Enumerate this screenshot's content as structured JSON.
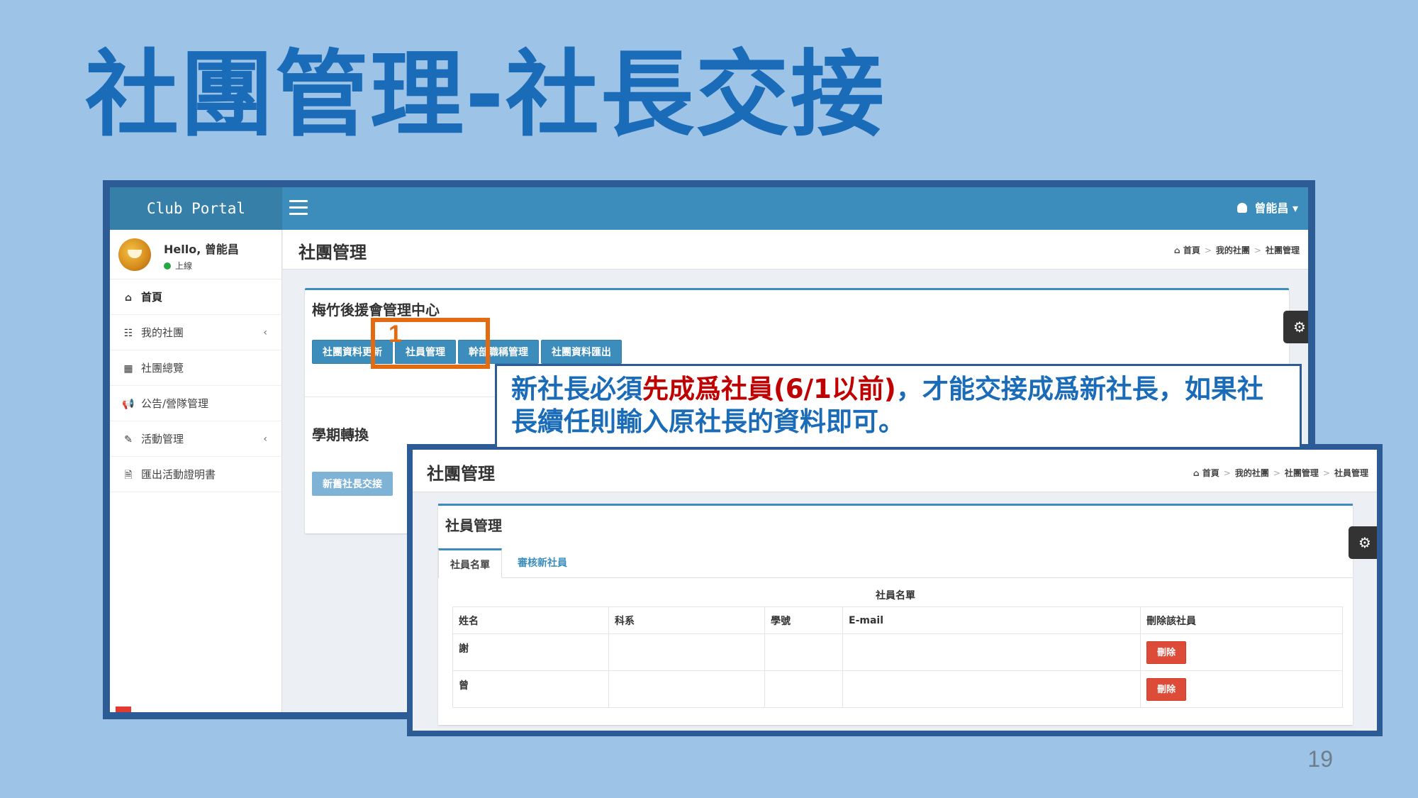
{
  "slide": {
    "title": "社團管理-社長交接",
    "page_number": "19"
  },
  "portal": {
    "logo": "Club Portal",
    "user_name": "曾能昌",
    "caret": "▾",
    "hello": "Hello, 曾能昌",
    "status": "上線",
    "menu": [
      {
        "label": "首頁",
        "icon": "home-icon",
        "glyph": "⌂"
      },
      {
        "label": "我的社團",
        "icon": "grid-icon",
        "glyph": "☷"
      },
      {
        "label": "社團總覽",
        "icon": "table-icon",
        "glyph": "▦"
      },
      {
        "label": "公告/營隊管理",
        "icon": "bullhorn-icon",
        "glyph": "📢"
      },
      {
        "label": "活動管理",
        "icon": "edit-icon",
        "glyph": "✎"
      },
      {
        "label": "匯出活動證明書",
        "icon": "document-icon",
        "glyph": "🗎"
      }
    ],
    "chevron": "‹",
    "page_title": "社團管理",
    "breadcrumb": [
      "首頁",
      "我的社團",
      "社團管理"
    ],
    "breadcrumb_sep": ">",
    "home_glyph": "⌂",
    "gear_glyph": "⚙",
    "box_title": "梅竹後援會管理中心",
    "buttons": [
      "社團資料更新",
      "社員管理",
      "幹部職稱管理",
      "社團資料匯出"
    ],
    "section_title": "學期轉換",
    "semester_button": "新舊社長交接"
  },
  "callout": {
    "part1": "新社長必須",
    "part2_red": "先成爲社員(6/1以前)",
    "part3": "，才能交接成爲新社長，如果社長續任則輸入原社長的資料即可。"
  },
  "highlight": {
    "step_number": "1"
  },
  "members_screen": {
    "page_title": "社團管理",
    "breadcrumb": [
      "首頁",
      "我的社團",
      "社團管理",
      "社員管理"
    ],
    "box_title": "社員管理",
    "tabs": [
      "社員名單",
      "審核新社員"
    ],
    "table_caption": "社員名單",
    "columns": [
      "姓名",
      "科系",
      "學號",
      "E-mail",
      "刪除該社員"
    ],
    "rows": [
      {
        "name": "謝",
        "dept": "",
        "id": "",
        "email": "",
        "action": "刪除"
      },
      {
        "name": "曾",
        "dept": "",
        "id": "",
        "email": "",
        "action": "刪除"
      }
    ]
  },
  "colors": {
    "title_blue": "#1a6bb8",
    "header_blue": "#3c8dbc",
    "highlight_orange": "#e26b12",
    "callout_red": "#c00000",
    "delete_red": "#dd4b39"
  }
}
